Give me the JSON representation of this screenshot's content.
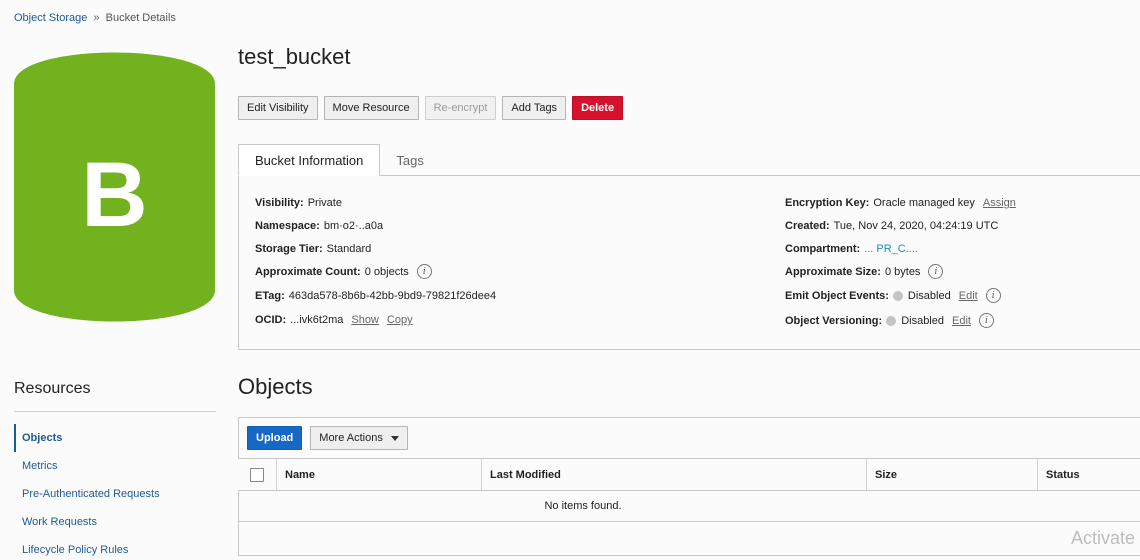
{
  "breadcrumb": {
    "root": "Object Storage",
    "separator": "»",
    "current": "Bucket Details"
  },
  "bucket_icon": {
    "letter": "B",
    "color": "#72b21e"
  },
  "bucket": {
    "name": "test_bucket"
  },
  "actions": {
    "edit_visibility": "Edit Visibility",
    "move_resource": "Move Resource",
    "re_encrypt": "Re-encrypt",
    "add_tags": "Add Tags",
    "delete": "Delete"
  },
  "tabs": {
    "bucket_information": "Bucket Information",
    "tags": "Tags"
  },
  "info": {
    "visibility_label": "Visibility:",
    "visibility_value": "Private",
    "namespace_label": "Namespace:",
    "namespace_value": "bm·o2·..a0a",
    "storage_tier_label": "Storage Tier:",
    "storage_tier_value": "Standard",
    "approx_count_label": "Approximate Count:",
    "approx_count_value": "0 objects",
    "etag_label": "ETag:",
    "etag_value": "463da578-8b6b-42bb-9bd9-79821f26dee4",
    "ocid_label": "OCID:",
    "ocid_value": "...ivk6t2ma",
    "ocid_show": "Show",
    "ocid_copy": "Copy",
    "encryption_label": "Encryption Key:",
    "encryption_value": "Oracle managed key",
    "encryption_assign": "Assign",
    "created_label": "Created:",
    "created_value": "Tue, Nov 24, 2020, 04:24:19 UTC",
    "compartment_label": "Compartment:",
    "compartment_value": "...  PR_C....",
    "approx_size_label": "Approximate Size:",
    "approx_size_value": "0 bytes",
    "emit_events_label": "Emit Object Events:",
    "emit_events_value": "Disabled",
    "emit_events_edit": "Edit",
    "versioning_label": "Object Versioning:",
    "versioning_value": "Disabled",
    "versioning_edit": "Edit"
  },
  "resources": {
    "title": "Resources",
    "items": [
      "Objects",
      "Metrics",
      "Pre-Authenticated Requests",
      "Work Requests",
      "Lifecycle Policy Rules"
    ]
  },
  "objects": {
    "title": "Objects",
    "upload": "Upload",
    "more_actions": "More Actions",
    "columns": [
      "Name",
      "Last Modified",
      "Size",
      "Status"
    ],
    "empty_message": "No items found."
  },
  "watermark": "Activate"
}
